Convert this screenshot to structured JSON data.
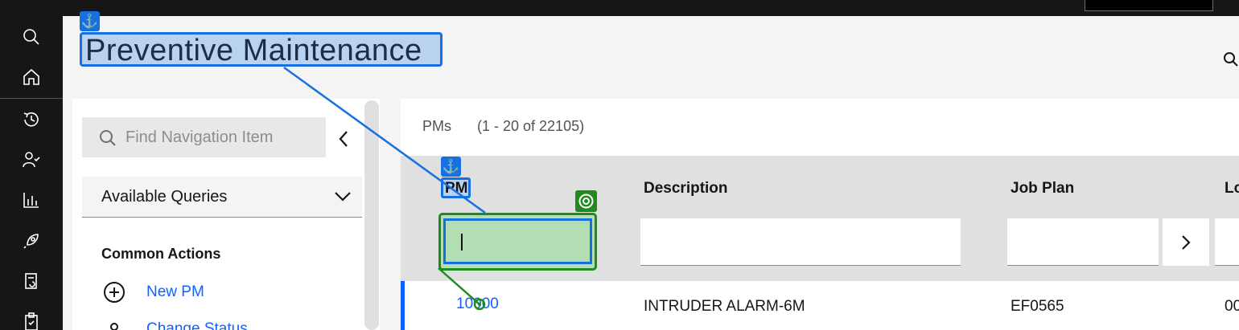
{
  "app": {
    "page_title": "Preventive Maintenance",
    "accent_color": "#0f62fe",
    "overlay_blue": "#1670e0",
    "overlay_green": "#1e8b1e"
  },
  "rail": {
    "items": [
      {
        "icon": "search-icon"
      },
      {
        "icon": "home-icon"
      },
      {
        "icon": "history-icon"
      },
      {
        "icon": "user-check-icon"
      },
      {
        "icon": "reports-icon"
      },
      {
        "icon": "rocket-icon"
      },
      {
        "icon": "refresh-list-icon"
      },
      {
        "icon": "clipboard-icon"
      }
    ]
  },
  "nav": {
    "search_placeholder": "Find Navigation Item",
    "queries_label": "Available Queries",
    "common_actions": "Common Actions",
    "actions": [
      {
        "label": "New PM",
        "icon": "add-circle-icon"
      },
      {
        "label": "Change Status",
        "icon": "status-icon"
      }
    ]
  },
  "list": {
    "title": "PMs",
    "count": "(1 - 20 of 22105)",
    "columns": [
      "PM",
      "Description",
      "Job Plan",
      "Lo"
    ],
    "rows": [
      {
        "pm": "10000",
        "description": "INTRUDER ALARM-6M",
        "job_plan": "EF0565",
        "location": "00"
      }
    ]
  },
  "annotations": {
    "anchor_glyph": "⚓"
  }
}
